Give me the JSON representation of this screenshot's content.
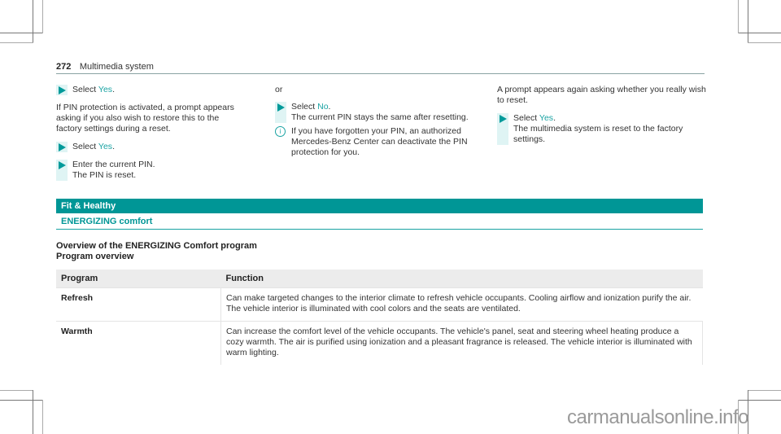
{
  "header": {
    "page_number": "272",
    "section_title": "Multimedia system"
  },
  "column1": {
    "step1": {
      "prefix": "Select ",
      "option": "Yes",
      "suffix": "."
    },
    "paragraph": "If PIN protection is activated, a prompt appears asking if you also wish to restore this to the factory settings during a reset.",
    "step2": {
      "prefix": "Select ",
      "option": "Yes",
      "suffix": "."
    },
    "step3": {
      "line1": "Enter the current PIN.",
      "line2": "The PIN is reset."
    }
  },
  "column2": {
    "or_label": "or",
    "step1": {
      "prefix": "Select ",
      "option": "No",
      "suffix": ".",
      "result": "The current PIN stays the same after resetting."
    },
    "info_icon": "info-circle-icon",
    "info_text": "If you have forgotten your PIN, an authorized Mercedes-Benz Center can deactivate the PIN protection for you."
  },
  "column3": {
    "paragraph": "A prompt appears again asking whether you really wish to reset.",
    "step1": {
      "prefix": "Select ",
      "option": "Yes",
      "suffix": ".",
      "result": "The multimedia system is reset to the factory settings."
    }
  },
  "banner": "Fit & Healthy",
  "subheading": "ENERGIZING comfort",
  "overview": {
    "title": "Overview of the ENERGIZING Comfort program",
    "subtitle": "Program overview"
  },
  "table": {
    "headers": [
      "Program",
      "Function"
    ],
    "rows": [
      {
        "program": "Refresh",
        "function": "Can make targeted changes to the interior climate to refresh vehicle occupants. Cooling airflow and ionization purify the air. The vehicle interior is illuminated with cool colors and the seats are ventilated."
      },
      {
        "program": "Warmth",
        "function": "Can increase the comfort level of the vehicle occupants. The vehicle's panel, seat and steering wheel heating produce a cozy warmth. The air is purified using ionization and a pleasant fragrance is released. The vehicle interior is illuminated with warm lighting."
      }
    ]
  },
  "colors": {
    "accent": "#009696",
    "highlight_text": "#1aa3a3",
    "step_bar": "#dff4f4"
  },
  "watermark": "carmanualsonline.info"
}
